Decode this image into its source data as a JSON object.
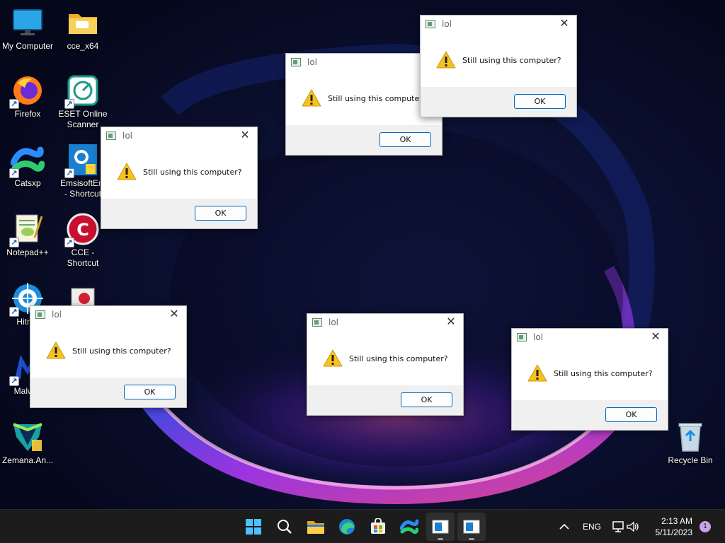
{
  "desktop": {
    "icons": [
      {
        "label": "My Computer",
        "icon": "monitor-icon"
      },
      {
        "label": "cce_x64",
        "icon": "folder-icon"
      },
      {
        "label": "Firefox",
        "icon": "firefox-icon"
      },
      {
        "label": "ESET Online\nScanner",
        "icon": "eset-icon"
      },
      {
        "label": "Catsxp",
        "icon": "catsxp-icon"
      },
      {
        "label": "EmsisoftEm\n- Shortcut",
        "icon": "emsisoft-icon"
      },
      {
        "label": "Notepad++",
        "icon": "notepadpp-icon"
      },
      {
        "label": "CCE -\nShortcut",
        "icon": "cce-icon"
      },
      {
        "label": "Hitma",
        "icon": "hitmanpro-icon"
      },
      {
        "label": "",
        "icon": "toolbox-icon"
      },
      {
        "label": "Malwar",
        "icon": "malwarebytes-icon"
      },
      {
        "label": "Zemana.An...",
        "icon": "zemana-icon"
      },
      {
        "label": "Recycle Bin",
        "icon": "recycle-bin-icon"
      }
    ]
  },
  "dialogs": [
    {
      "title": "lol",
      "message": "Still using this computer?",
      "ok": "OK"
    },
    {
      "title": "lol",
      "message": "Still using this computer?",
      "ok": "OK"
    },
    {
      "title": "lol",
      "message": "Still using this computer?",
      "ok": "OK"
    },
    {
      "title": "lol",
      "message": "Still using this computer?",
      "ok": "OK"
    },
    {
      "title": "lol",
      "message": "Still using this computer?",
      "ok": "OK"
    },
    {
      "title": "lol",
      "message": "Still using this computer?",
      "ok": "OK"
    }
  ],
  "taskbar": {
    "apps": [
      "start-icon",
      "search-icon",
      "file-explorer-icon",
      "edge-icon",
      "store-icon",
      "catsxp-icon",
      "dialog-app-icon",
      "dialog-app-icon"
    ],
    "tray": {
      "language": "ENG",
      "time": "2:13 AM",
      "date": "5/11/2023",
      "notification_count": "1"
    }
  },
  "colors": {
    "accent": "#0067c0",
    "taskbar": "#1c1c1c",
    "warning": "#f7c21d"
  }
}
